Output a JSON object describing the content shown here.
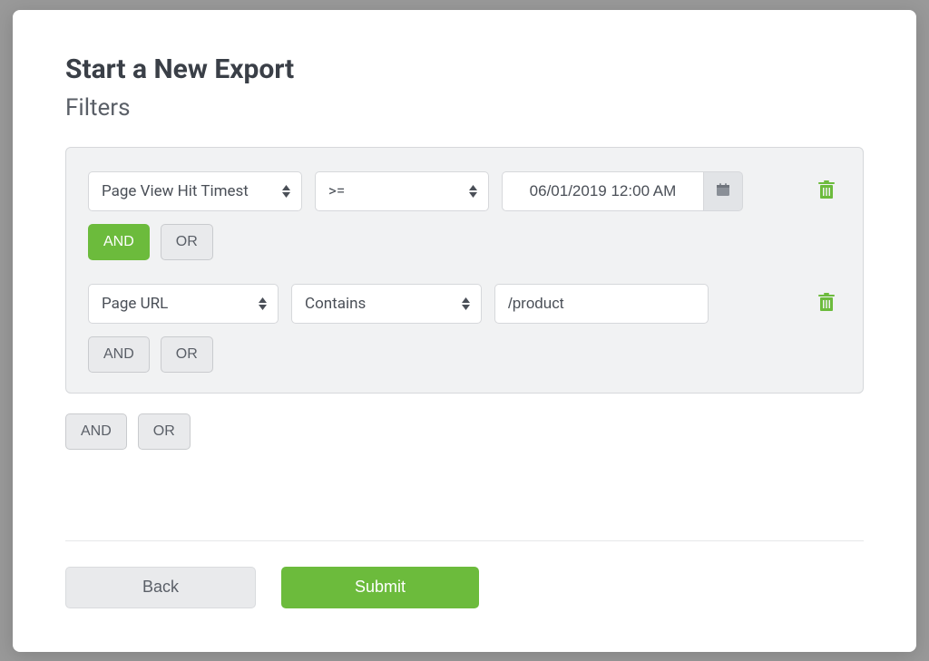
{
  "title": "Start a New Export",
  "section": "Filters",
  "filters": {
    "group": {
      "rows": [
        {
          "field": "Page View Hit Timest",
          "operator": ">=",
          "value": "06/01/2019 12:00 AM",
          "and_label": "AND",
          "or_label": "OR",
          "and_active": true
        },
        {
          "field": "Page URL",
          "operator": "Contains",
          "value": "/product",
          "and_label": "AND",
          "or_label": "OR",
          "and_active": false
        }
      ]
    },
    "outer": {
      "and_label": "AND",
      "or_label": "OR"
    }
  },
  "actions": {
    "back": "Back",
    "submit": "Submit"
  },
  "icons": {
    "trash": "trash-icon",
    "calendar": "calendar-icon"
  },
  "colors": {
    "accent": "#6cbb3c"
  }
}
